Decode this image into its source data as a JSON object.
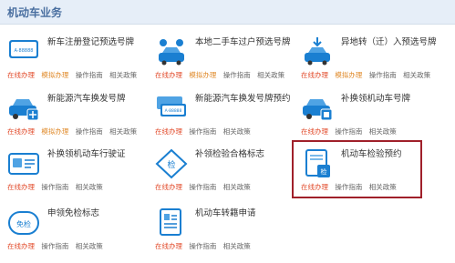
{
  "header": {
    "title": "机动车业务"
  },
  "colors": {
    "accent": "#1a7fd1",
    "online": "#e24b2b",
    "mock": "#e08a2a",
    "highlight_box": "#a0202a"
  },
  "services": [
    {
      "title": "新车注册登记预选号牌",
      "links": {
        "online": "在线办理",
        "mock": "模拟办理",
        "guide": "操作指南",
        "policy": "相关政策"
      }
    },
    {
      "title": "本地二手车过户预选号牌",
      "links": {
        "online": "在线办理",
        "mock": "模拟办理",
        "guide": "操作指南",
        "policy": "相关政策"
      }
    },
    {
      "title": "异地转（迁）入预选号牌",
      "links": {
        "online": "在线办理",
        "mock": "模拟办理",
        "guide": "操作指南",
        "policy": "相关政策"
      }
    },
    {
      "title": "新能源汽车换发号牌",
      "links": {
        "online": "在线办理",
        "mock": "模拟办理",
        "guide": "操作指南",
        "policy": "相关政策"
      }
    },
    {
      "title": "新能源汽车换发号牌预约",
      "links": {
        "online": "在线办理",
        "guide": "操作指南",
        "policy": "相关政策"
      }
    },
    {
      "title": "补换领机动车号牌",
      "links": {
        "online": "在线办理",
        "guide": "操作指南",
        "policy": "相关政策"
      }
    },
    {
      "title": "补换领机动车行驶证",
      "links": {
        "online": "在线办理",
        "guide": "操作指南",
        "policy": "相关政策"
      }
    },
    {
      "title": "补领检验合格标志",
      "links": {
        "online": "在线办理",
        "guide": "操作指南",
        "policy": "相关政策"
      }
    },
    {
      "title": "机动车检验预约",
      "links": {
        "online": "在线办理",
        "guide": "操作指南",
        "policy": "相关政策"
      }
    },
    {
      "title": "申领免检标志",
      "links": {
        "online": "在线办理",
        "guide": "操作指南",
        "policy": "相关政策"
      }
    },
    {
      "title": "机动车转籍申请",
      "links": {
        "online": "在线办理",
        "guide": "操作指南",
        "policy": "相关政策"
      }
    }
  ],
  "icons": [
    {
      "name": "plate-icon"
    },
    {
      "name": "car-transfer-icon"
    },
    {
      "name": "import-car-icon"
    },
    {
      "name": "ev-car-icon"
    },
    {
      "name": "plate-stack-icon"
    },
    {
      "name": "replace-plate-icon"
    },
    {
      "name": "license-card-icon"
    },
    {
      "name": "inspection-diamond-icon",
      "text": "检"
    },
    {
      "name": "inspection-doc-icon",
      "text": "检"
    },
    {
      "name": "exemption-badge-icon",
      "text": "免检"
    },
    {
      "name": "transfer-doc-icon"
    }
  ],
  "plate_texts": {
    "icon_plate": "A·88888",
    "icon_stack": "A·88888"
  }
}
